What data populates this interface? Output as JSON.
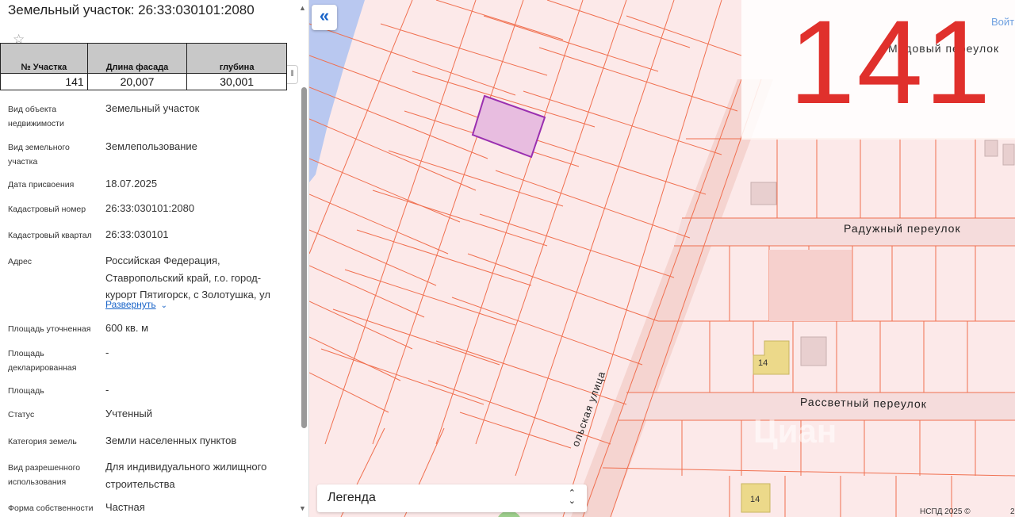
{
  "panel": {
    "title": "Земельный участок: 26:33:030101:2080",
    "star_icon": "☆",
    "side_tab_icon": "⦀"
  },
  "overlay_table": {
    "headers": [
      "№ Участка",
      "Длина фасада",
      "глубина"
    ],
    "row": [
      "141",
      "20,007",
      "30,001"
    ]
  },
  "properties": [
    {
      "label": "Вид объекта недвижимости",
      "value": "Земельный участок"
    },
    {
      "label": "Вид земельного участка",
      "value": "Землепользование"
    },
    {
      "label": "Дата присвоения",
      "value": "18.07.2025"
    },
    {
      "label": "Кадастровый номер",
      "value": "26:33:030101:2080"
    },
    {
      "label": "Кадастровый квартал",
      "value": "26:33:030101"
    },
    {
      "label": "Адрес",
      "value": "Российская Федерация, Ставропольский край, г.о. город-курорт Пятигорск, с Золотушка, ул"
    },
    {
      "label": "Площадь уточненная",
      "value": "600 кв. м"
    },
    {
      "label": "Площадь декларированная",
      "value": "-"
    },
    {
      "label": "Площадь",
      "value": "-"
    },
    {
      "label": "Статус",
      "value": "Учтенный"
    },
    {
      "label": "Категория земель",
      "value": "Земли населенных пунктов"
    },
    {
      "label": "Вид разрешенного использования",
      "value": "Для индивидуального жилищного строительства"
    },
    {
      "label": "Форма собственности",
      "value": "Частная"
    }
  ],
  "expand_link": "Развернуть",
  "map": {
    "collapse_icon": "«",
    "big_label": "141",
    "login": "Войти",
    "legend_label": "Легенда",
    "copyright": "НСПД 2025 ©",
    "scale": "2",
    "streets": [
      "Радужный переулок",
      "Рассветный переулок",
      "Медовый переулок",
      "ольская улица"
    ],
    "house_numbers": [
      "14",
      "14"
    ],
    "watermark": "Циан",
    "colors": {
      "parcel_line": "#f07050",
      "selected_fill": "#e8bde0",
      "selected_stroke": "#9a2fb0",
      "big_label": "#e0302c",
      "water": "#b9c8f0"
    }
  }
}
